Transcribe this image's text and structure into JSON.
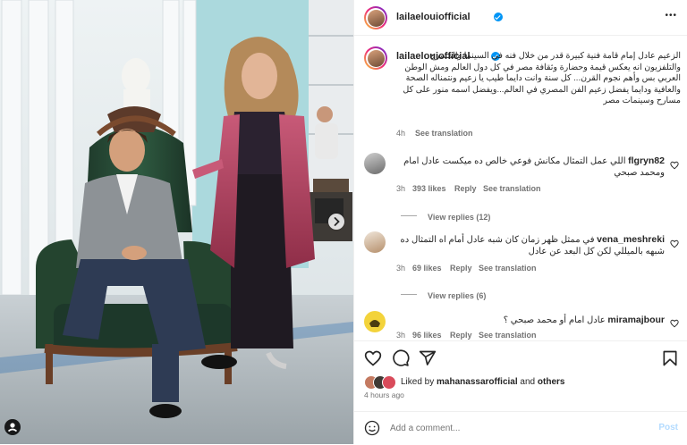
{
  "post": {
    "username": "lailaelouiofficial",
    "more_label": "•••"
  },
  "caption": {
    "username": "lailaelouiofficial",
    "text": "الزعيم عادل إمام قامة فنية كبيرة قدر من خلال فنه في السينما والمسرح والتلفزيون انه يعكس قيمة وحضارة وثقافة مصر في كل دول العالم ومش الوطن العربي بس وأهم نجوم القرن... كل سنة وانت دايما طيب يا زعيم ونتمناله الصحة والعافية ودايما يفضل زعيم الفن المصري في العالم...ويفضل اسمه منور على كل مسارح وسينمات مصر",
    "time": "4h",
    "translate": "See translation"
  },
  "comments": [
    {
      "username": "flgryn82",
      "text": "اللي عمل التمثال مكانش فوعي خالص ده ميكست عادل امام ومحمد صبحي",
      "time": "3h",
      "likes": "393 likes",
      "reply": "Reply",
      "translate": "See translation",
      "view_replies": "View replies (12)"
    },
    {
      "username": "vena_meshreki",
      "text": "في ممثل ظهر زمان كان شبه عادل أمام اه التمثال ده شبهه بالميللي لكن كل البعد عن عادل",
      "time": "3h",
      "likes": "69 likes",
      "reply": "Reply",
      "translate": "See translation",
      "view_replies": "View replies (6)"
    },
    {
      "username": "miramajbour",
      "text": "عادل امام أو محمد صبحي ؟",
      "time": "3h",
      "likes": "96 likes",
      "reply": "Reply",
      "translate": "See translation"
    }
  ],
  "likes_line": {
    "liked_by": "Liked by",
    "user": "mahanassarofficial",
    "and": "and",
    "others": "others"
  },
  "post_time": "4 hours ago",
  "add_comment": {
    "placeholder": "Add a comment...",
    "post_label": "Post"
  },
  "icons": {
    "like": "heart-icon",
    "comment": "comment-icon",
    "share": "send-icon",
    "save": "bookmark-icon",
    "next": "chevron-right-icon",
    "emoji": "emoji-icon",
    "tag": "user-tag-icon"
  },
  "colors": {
    "verified": "#0095f6",
    "link_blue": "#0095f6",
    "muted": "#737373"
  }
}
